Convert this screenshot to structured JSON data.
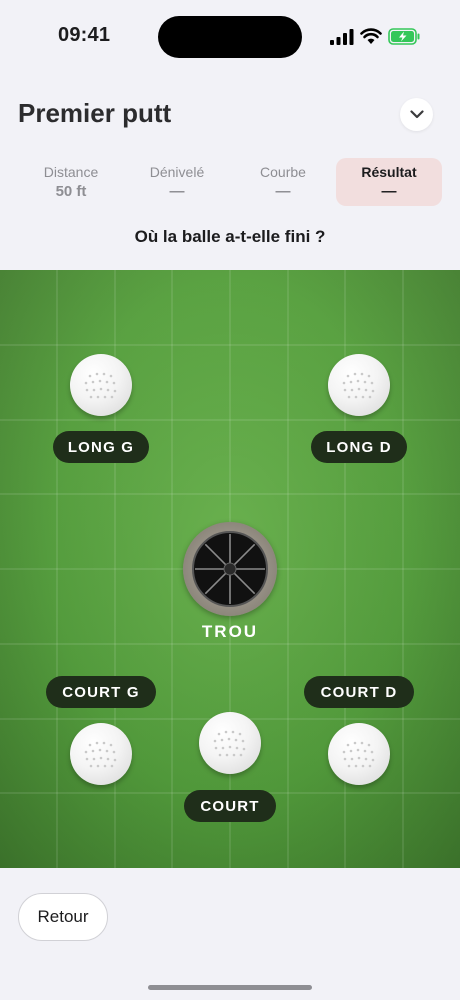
{
  "status": {
    "time": "09:41"
  },
  "header": {
    "title": "Premier putt"
  },
  "steps": [
    {
      "label": "Distance",
      "value": "50 ft"
    },
    {
      "label": "Dénivelé",
      "value": "—"
    },
    {
      "label": "Courbe",
      "value": "—"
    },
    {
      "label": "Résultat",
      "value": "—"
    }
  ],
  "question": "Où la balle a-t-elle fini ?",
  "green": {
    "hole_label": "TROU",
    "positions": {
      "long_left": "LONG G",
      "long_right": "LONG D",
      "short_left": "COURT G",
      "short_right": "COURT D",
      "short": "COURT"
    }
  },
  "footer": {
    "back_label": "Retour"
  },
  "colors": {
    "green": "#5da544",
    "tag_bg": "#1f2e1a",
    "active_step_bg": "#f2dede",
    "battery": "#34c759"
  }
}
